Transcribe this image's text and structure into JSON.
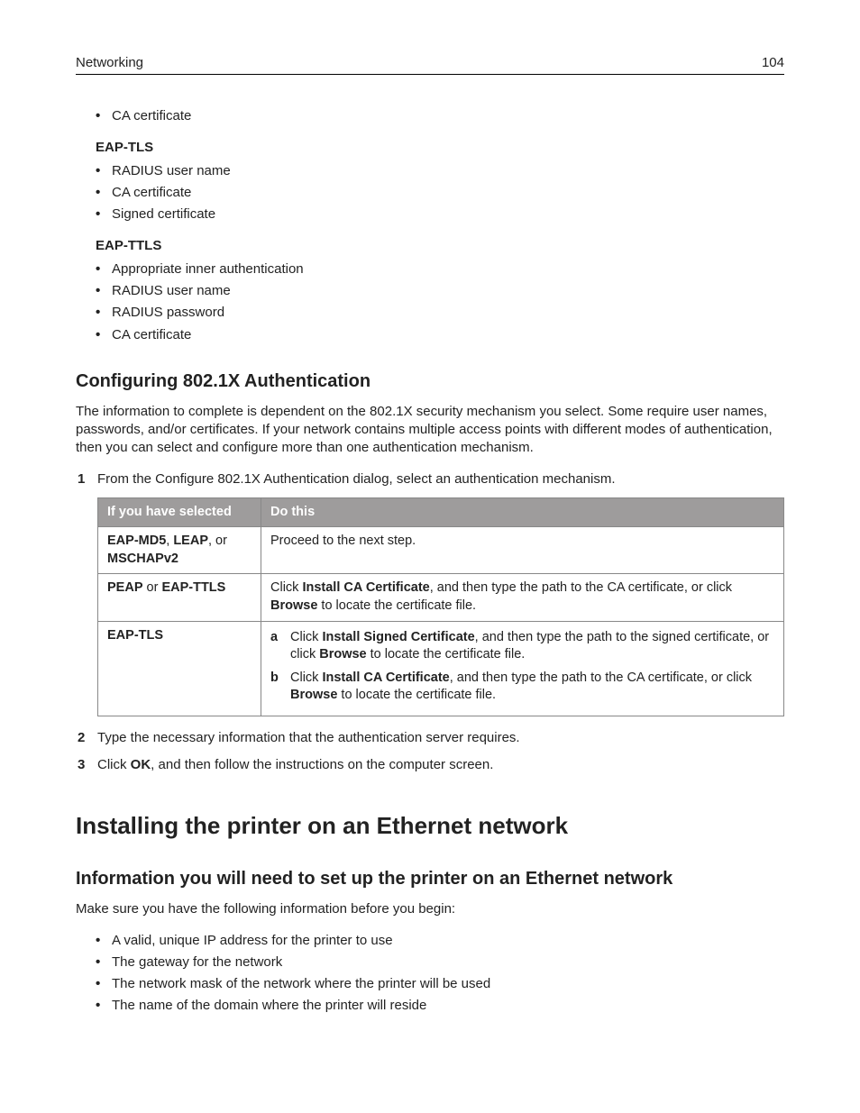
{
  "header": {
    "section": "Networking",
    "page": "104"
  },
  "top_bullets": {
    "group0_items": [
      "CA certificate"
    ],
    "group1_label": "EAP‑TLS",
    "group1_items": [
      "RADIUS user name",
      "CA certificate",
      "Signed certificate"
    ],
    "group2_label": "EAP‑TTLS",
    "group2_items": [
      "Appropriate inner authentication",
      "RADIUS user name",
      "RADIUS password",
      "CA certificate"
    ]
  },
  "config_section": {
    "title": "Configuring 802.1X Authentication",
    "intro": "The information to complete is dependent on the 802.1X security mechanism you select. Some require user names, passwords, and/or certificates. If your network contains multiple access points with different modes of authentication, then you can select and configure more than one authentication mechanism.",
    "step1": "From the Configure 802.1X Authentication dialog, select an authentication mechanism.",
    "table": {
      "colA": "If you have selected",
      "colB": "Do this",
      "row1": {
        "a_parts": [
          "EAP‑MD5",
          ", ",
          "LEAP",
          ", or ",
          "MSCHAPv2"
        ],
        "b": "Proceed to the next step."
      },
      "row2": {
        "a_parts": [
          "PEAP",
          " or ",
          "EAP‑TTLS"
        ],
        "b_parts": [
          "Click ",
          "Install CA Certificate",
          ", and then type the path to the CA certificate, or click ",
          "Browse",
          " to locate the certificate file."
        ]
      },
      "row3": {
        "a": "EAP‑TLS",
        "sub_a_parts": [
          "Click ",
          "Install Signed Certificate",
          ", and then type the path to the signed certificate, or click ",
          "Browse",
          " to locate the certificate file."
        ],
        "sub_b_parts": [
          "Click ",
          "Install CA Certificate",
          ", and then type the path to the CA certificate, or click ",
          "Browse",
          " to locate the certificate file."
        ]
      }
    },
    "step2": "Type the necessary information that the authentication server requires.",
    "step3_parts": [
      "Click ",
      "OK",
      ", and then follow the instructions on the computer screen."
    ]
  },
  "install_section": {
    "title": "Installing the printer on an Ethernet network",
    "subtitle": "Information you will need to set up the printer on an Ethernet network",
    "intro": "Make sure you have the following information before you begin:",
    "items": [
      "A valid, unique IP address for the printer to use",
      "The gateway for the network",
      "The network mask of the network where the printer will be used",
      "The name of the domain where the printer will reside"
    ]
  }
}
